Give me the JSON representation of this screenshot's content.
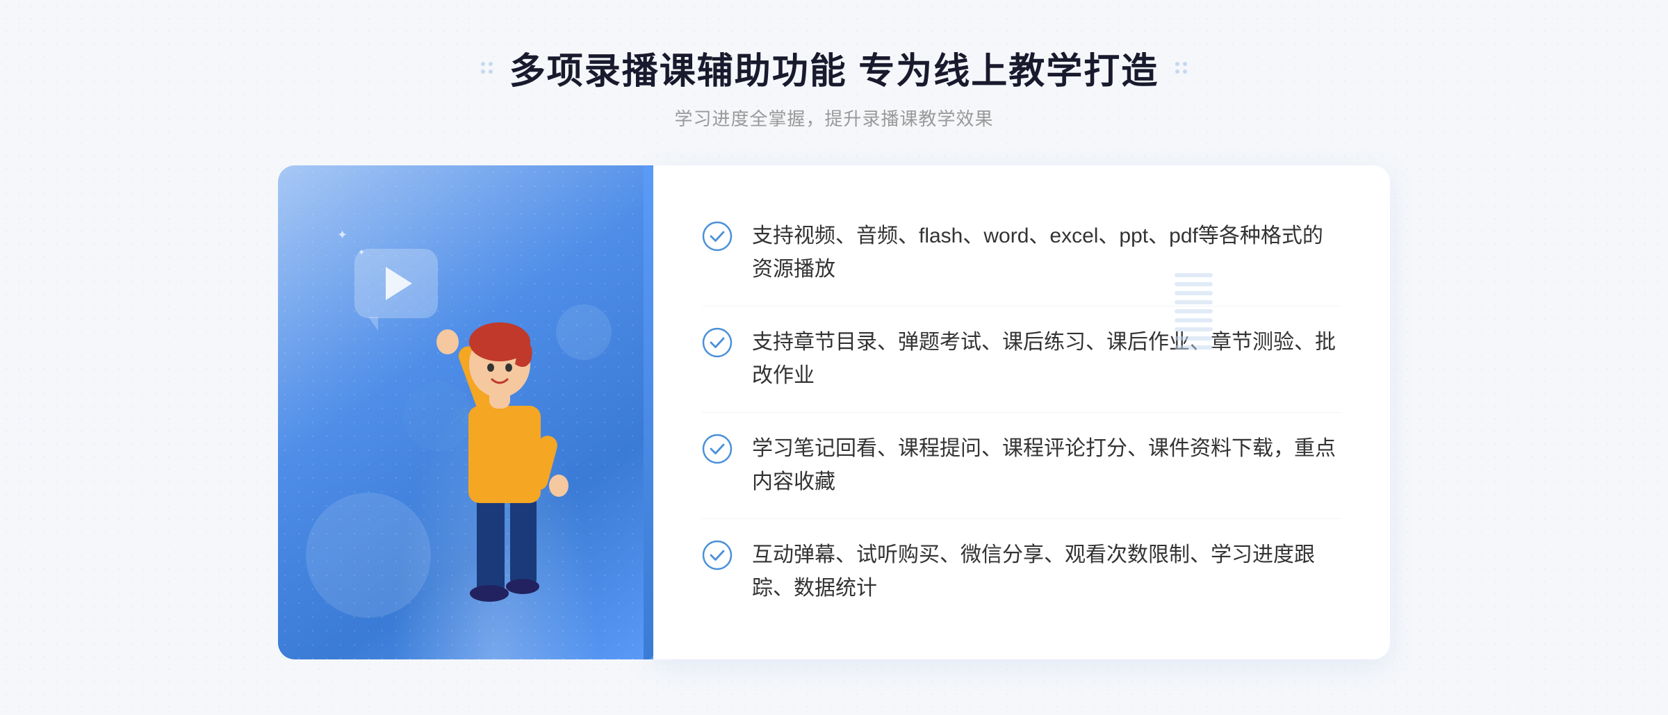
{
  "header": {
    "title": "多项录播课辅助功能 专为线上教学打造",
    "subtitle": "学习进度全掌握，提升录播课教学效果",
    "dots_left": "decorative-dots",
    "dots_right": "decorative-dots"
  },
  "features": [
    {
      "id": 1,
      "text": "支持视频、音频、flash、word、excel、ppt、pdf等各种格式的资源播放"
    },
    {
      "id": 2,
      "text": "支持章节目录、弹题考试、课后练习、课后作业、章节测验、批改作业"
    },
    {
      "id": 3,
      "text": "学习笔记回看、课程提问、课程评论打分、课件资料下载，重点内容收藏"
    },
    {
      "id": 4,
      "text": "互动弹幕、试听购买、微信分享、观看次数限制、学习进度跟踪、数据统计"
    }
  ],
  "colors": {
    "primary_blue": "#3a7bd5",
    "light_blue": "#a8c8f5",
    "check_color": "#4a90d9",
    "text_dark": "#1a1a2e",
    "text_gray": "#999999",
    "text_body": "#333333"
  },
  "decoration": {
    "chevron_left": "»"
  }
}
